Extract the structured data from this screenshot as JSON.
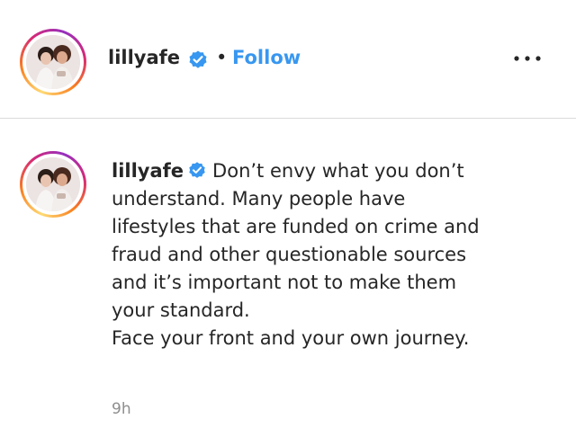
{
  "post": {
    "header": {
      "username": "lillyafe",
      "separator": "•",
      "follow_label": "Follow",
      "more_icon": "more-horizontal-icon"
    },
    "caption": {
      "username": "lillyafe",
      "lines": [
        "Don’t envy what you don’t",
        "understand. Many people have",
        "lifestyles that are funded on crime and",
        "fraud and other questionable sources",
        "and it’s important not to make them",
        "your standard.",
        "Face your front and your own journey."
      ],
      "timestamp": "9h"
    },
    "colors": {
      "follow_blue": "#3897f0",
      "verified_blue": "#3897f0",
      "text": "#262626",
      "muted": "#8e8e8e",
      "divider": "#dbdbdb"
    },
    "icons": {
      "verified": "verified-badge-icon",
      "avatar": "profile-avatar"
    }
  }
}
